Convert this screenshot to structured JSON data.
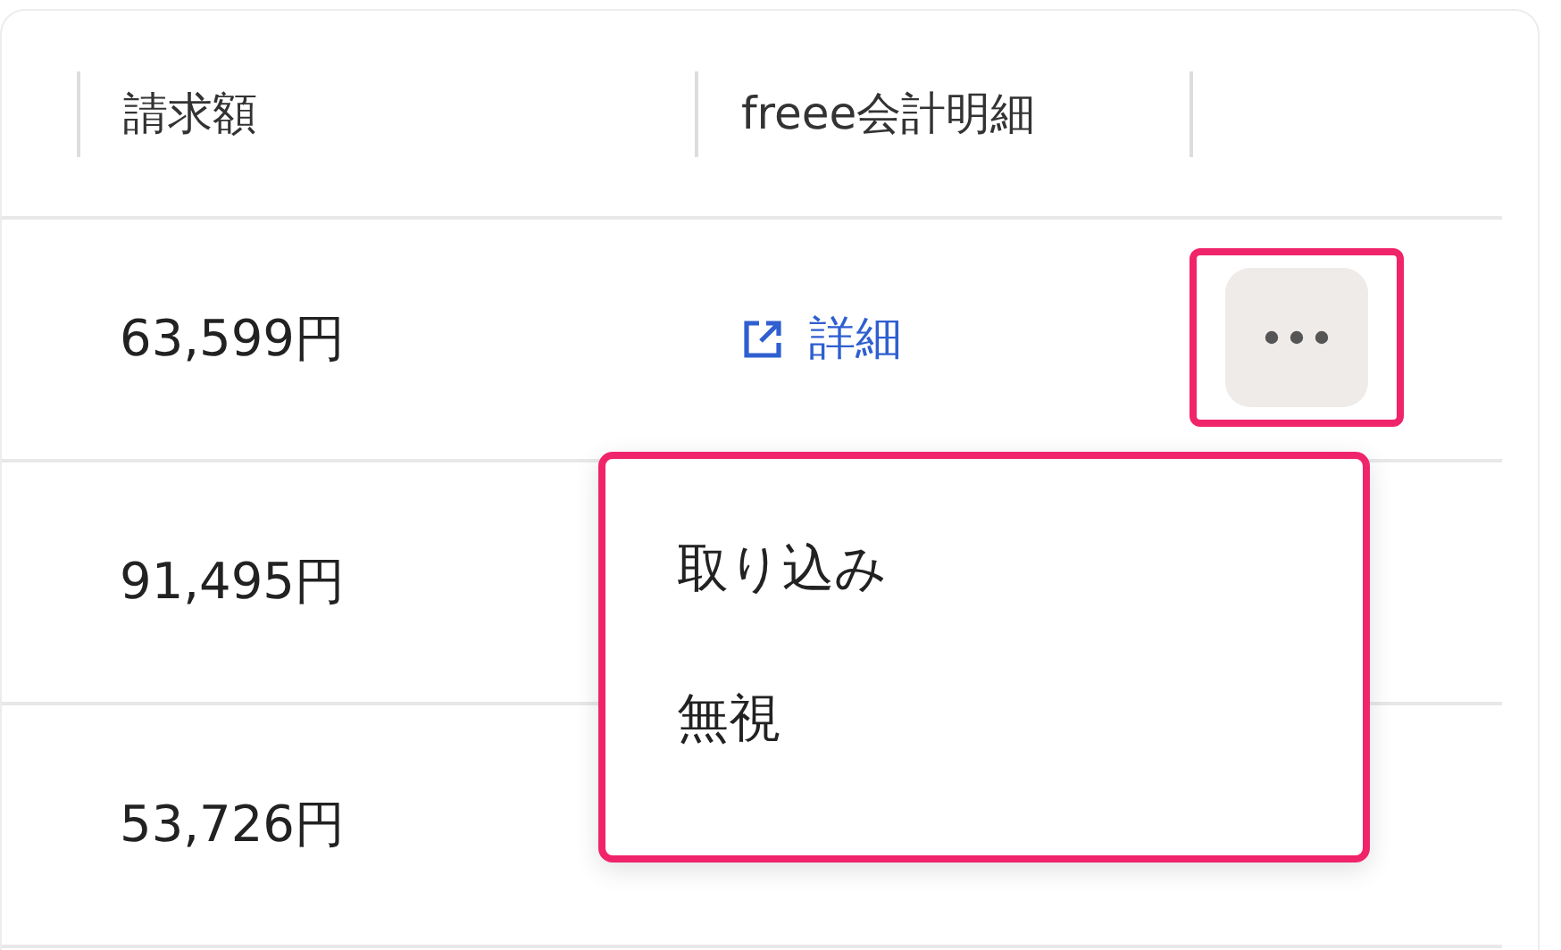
{
  "columns": [
    "請求額",
    "freee会計明細"
  ],
  "rows": [
    {
      "amount": "63,599円",
      "detail_link": "詳細",
      "menu_open": true
    },
    {
      "amount": "91,495円"
    },
    {
      "amount": "53,726円"
    }
  ],
  "menu": {
    "items": [
      {
        "label": "取り込み"
      },
      {
        "label": "無視"
      }
    ]
  }
}
